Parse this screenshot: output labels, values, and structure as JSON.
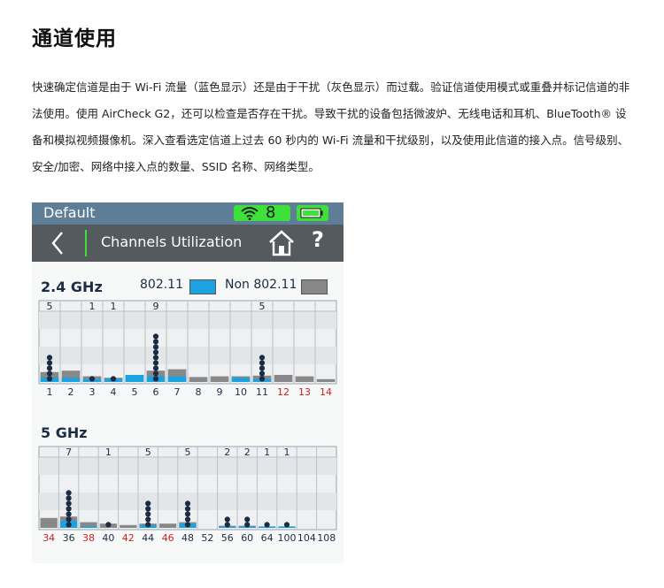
{
  "page": {
    "title": "通道使用",
    "paragraph": "快速确定信道是由于 Wi-Fi 流量（蓝色显示）还是由于干扰（灰色显示）而过载。验证信道使用模式或重叠并标记信道的非法使用。使用 AirCheck G2，还可以检查是否存在干扰。导致干扰的设备包括微波炉、无线电话和耳机、BlueTooth® 设备和模拟视频摄像机。深入查看选定信道上过去 60 秒内的 Wi-Fi 流量和干扰级别，以及使用此信道的接入点。信号级别、安全/加密、网络中接入点的数量、SSID 名称、网络类型。"
  },
  "device": {
    "status": {
      "profile": "Default",
      "wifi_count": "8",
      "wifi_icon": "wifi-icon",
      "battery_icon": "battery-icon"
    },
    "toolbar": {
      "back_icon": "back-arrow-icon",
      "title": "Channels Utilization",
      "home_icon": "home-icon",
      "help_label": "?"
    },
    "legend": {
      "wifi_label": "802.11",
      "non_wifi_label": "Non 802.11"
    },
    "colors": {
      "wifi": "#1aa3e0",
      "non_wifi": "#888888",
      "dot": "#1c2c44",
      "normal_channel": "#1c2c44",
      "restricted_channel": "#cc2222"
    }
  },
  "chart_data": [
    {
      "type": "bar",
      "title": "2.4 GHz",
      "categories": [
        "1",
        "2",
        "3",
        "4",
        "5",
        "6",
        "7",
        "8",
        "9",
        "10",
        "11",
        "12",
        "13",
        "14"
      ],
      "restricted": [
        false,
        false,
        false,
        false,
        false,
        false,
        false,
        false,
        false,
        false,
        false,
        true,
        true,
        true
      ],
      "ap_count_labels": [
        "5",
        "",
        "1",
        "1",
        "",
        "9",
        "",
        "",
        "",
        "",
        "5",
        "",
        "",
        ""
      ],
      "ap_dots": [
        5,
        0,
        1,
        1,
        0,
        9,
        0,
        0,
        0,
        0,
        5,
        0,
        0,
        0
      ],
      "series": [
        {
          "name": "802.11",
          "values": [
            3,
            3,
            2,
            2,
            5,
            4,
            4,
            0,
            0,
            3,
            2,
            0,
            0,
            0
          ]
        },
        {
          "name": "Non 802.11",
          "values": [
            7,
            8,
            4,
            3,
            5,
            8,
            9,
            3.5,
            4,
            4,
            4.5,
            5,
            4,
            2
          ]
        }
      ],
      "ylim": [
        0,
        50
      ]
    },
    {
      "type": "bar",
      "title": "5 GHz",
      "categories": [
        "34",
        "36",
        "38",
        "40",
        "42",
        "44",
        "46",
        "48",
        "52",
        "56",
        "60",
        "64",
        "100",
        "104",
        "108"
      ],
      "restricted": [
        true,
        false,
        true,
        false,
        true,
        false,
        true,
        false,
        false,
        false,
        false,
        false,
        false,
        false,
        false
      ],
      "ap_count_labels": [
        "",
        "7",
        "",
        "1",
        "",
        "5",
        "",
        "5",
        "",
        "2",
        "2",
        "1",
        "1",
        "",
        ""
      ],
      "ap_dots": [
        0,
        7,
        0,
        1,
        0,
        5,
        0,
        5,
        0,
        2,
        2,
        1,
        1,
        0,
        0
      ],
      "series": [
        {
          "name": "802.11",
          "values": [
            0,
            5,
            1,
            0,
            0,
            2,
            0,
            3,
            0,
            1,
            1,
            1,
            1,
            0,
            0
          ]
        },
        {
          "name": "Non 802.11",
          "values": [
            7,
            8,
            4,
            3,
            2,
            3,
            3,
            4,
            0,
            1.5,
            1.5,
            1,
            1,
            0,
            0
          ]
        }
      ],
      "ylim": [
        0,
        50
      ]
    }
  ]
}
